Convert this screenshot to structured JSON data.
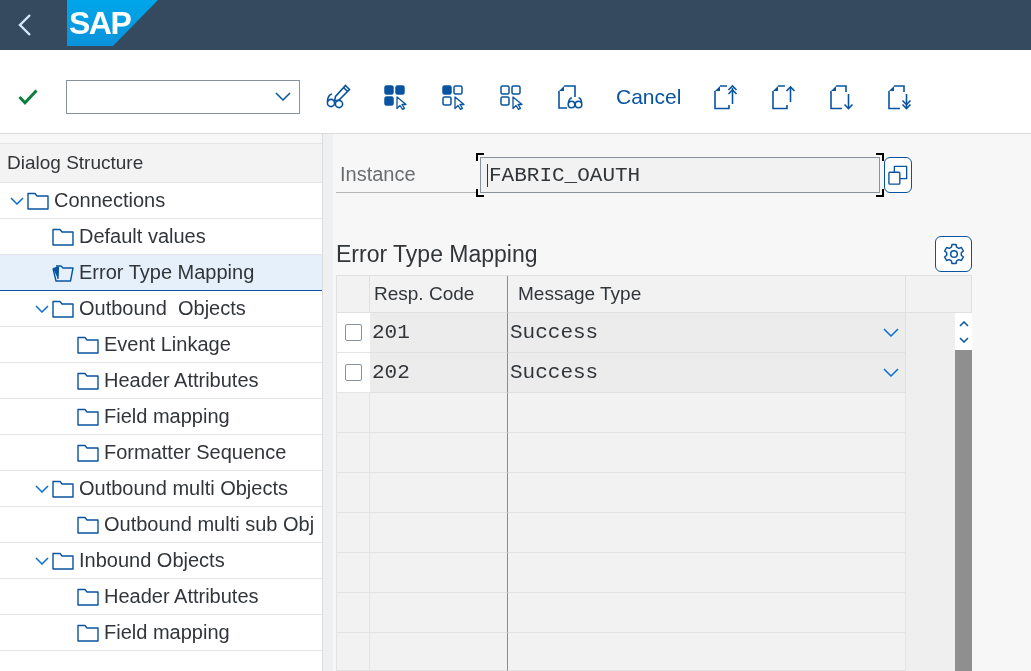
{
  "header": {
    "logo": "SAP"
  },
  "toolbar": {
    "cancel_label": "Cancel"
  },
  "dialog_structure": {
    "title": "Dialog Structure",
    "items": [
      {
        "label": "Connections",
        "selected": false,
        "expanded": true,
        "children": [
          {
            "label": "Default values",
            "selected": false
          },
          {
            "label": "Error Type Mapping",
            "selected": true
          },
          {
            "label": "Outbound  Objects",
            "selected": false,
            "expanded": true,
            "children": [
              {
                "label": "Event Linkage",
                "selected": false
              },
              {
                "label": "Header Attributes",
                "selected": false
              },
              {
                "label": "Field mapping",
                "selected": false
              },
              {
                "label": "Formatter Sequence",
                "selected": false
              }
            ]
          },
          {
            "label": "Outbound multi Objects",
            "selected": false,
            "expanded": true,
            "children": [
              {
                "label": "Outbound multi sub Obj",
                "selected": false
              }
            ]
          },
          {
            "label": "Inbound Objects",
            "selected": false,
            "expanded": true,
            "children": [
              {
                "label": "Header Attributes",
                "selected": false
              },
              {
                "label": "Field mapping",
                "selected": false
              }
            ]
          }
        ]
      }
    ]
  },
  "instance": {
    "label": "Instance",
    "value": "FABRIC_OAUTH",
    "focused": true
  },
  "error_type_mapping": {
    "title": "Error Type Mapping",
    "columns": [
      "Resp. Code",
      "Message Type"
    ],
    "rows": [
      {
        "resp_code": "201",
        "message_type": "Success",
        "selected": false
      },
      {
        "resp_code": "202",
        "message_type": "Success",
        "selected": false
      }
    ]
  }
}
